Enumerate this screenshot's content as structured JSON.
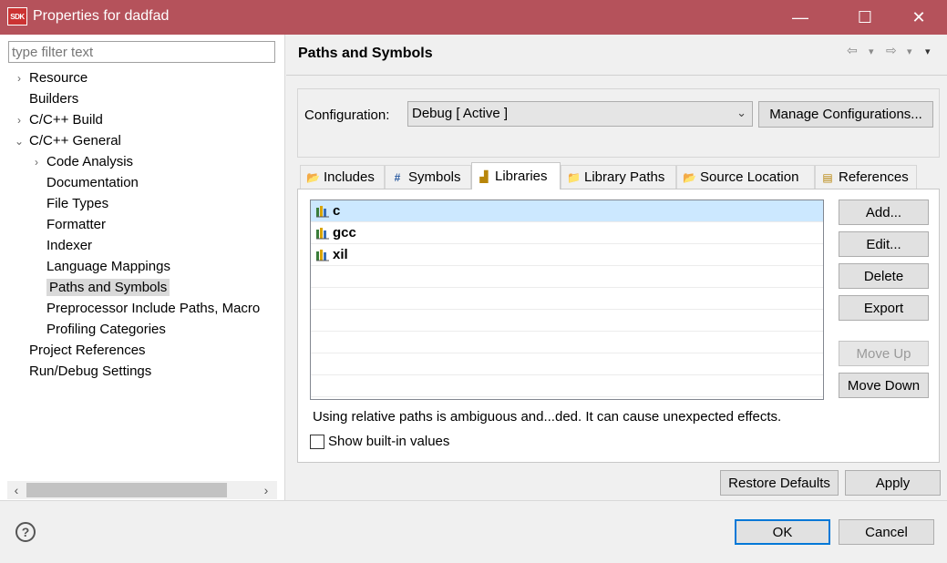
{
  "window": {
    "app_icon_text": "SDK",
    "title": "Properties for dadfad",
    "minimize": "—",
    "maximize": "☐",
    "close": "✕"
  },
  "filter": {
    "placeholder": "type filter text",
    "value": ""
  },
  "tree": [
    {
      "label": "Resource",
      "arrow": "›",
      "indent": 0
    },
    {
      "label": "Builders",
      "arrow": "",
      "indent": 0
    },
    {
      "label": "C/C++ Build",
      "arrow": "›",
      "indent": 0
    },
    {
      "label": "C/C++ General",
      "arrow": "⌄",
      "indent": 0
    },
    {
      "label": "Code Analysis",
      "arrow": "›",
      "indent": 1
    },
    {
      "label": "Documentation",
      "arrow": "",
      "indent": 1
    },
    {
      "label": "File Types",
      "arrow": "",
      "indent": 1
    },
    {
      "label": "Formatter",
      "arrow": "",
      "indent": 1
    },
    {
      "label": "Indexer",
      "arrow": "",
      "indent": 1
    },
    {
      "label": "Language Mappings",
      "arrow": "",
      "indent": 1
    },
    {
      "label": "Paths and Symbols",
      "arrow": "",
      "indent": 1,
      "selected": true
    },
    {
      "label": "Preprocessor Include Paths, Macro",
      "arrow": "",
      "indent": 1
    },
    {
      "label": "Profiling Categories",
      "arrow": "",
      "indent": 1
    },
    {
      "label": "Project References",
      "arrow": "",
      "indent": 0
    },
    {
      "label": "Run/Debug Settings",
      "arrow": "",
      "indent": 0
    }
  ],
  "scrollbar": {
    "left_arrow": "‹",
    "right_arrow": "›"
  },
  "page": {
    "title": "Paths and Symbols",
    "nav": {
      "back": "⇦",
      "back_menu": "▾",
      "forward": "⇨",
      "forward_menu": "▾",
      "view_menu": "▾"
    }
  },
  "configuration": {
    "label": "Configuration:",
    "selected": "Debug  [ Active ]",
    "chevron": "⌄",
    "manage_label": "Manage Configurations..."
  },
  "tabs": [
    {
      "label": "Includes",
      "icon": "includes-icon",
      "glyph": "📂",
      "active": false
    },
    {
      "label": "Symbols",
      "icon": "hash-icon",
      "glyph": "#",
      "active": false
    },
    {
      "label": "Libraries",
      "icon": "libraries-icon",
      "glyph": "▟",
      "active": true
    },
    {
      "label": "Library Paths",
      "icon": "library-paths-icon",
      "glyph": "📁",
      "active": false
    },
    {
      "label": "Source Location",
      "icon": "source-location-icon",
      "glyph": "📂",
      "active": false
    },
    {
      "label": "References",
      "icon": "references-icon",
      "glyph": "▤",
      "active": false
    }
  ],
  "libraries": [
    {
      "name": "c",
      "selected": true
    },
    {
      "name": "gcc",
      "selected": false
    },
    {
      "name": "xil",
      "selected": false
    }
  ],
  "side_buttons": {
    "add": "Add...",
    "edit": "Edit...",
    "delete": "Delete",
    "export": "Export",
    "move_up": "Move Up",
    "move_down": "Move Down"
  },
  "warning": "Using relative paths is ambiguous and...ded. It can cause unexpected effects.",
  "show_builtin": {
    "label": "Show built-in values",
    "checked": false
  },
  "bottom_buttons": {
    "restore": "Restore Defaults",
    "apply": "Apply"
  },
  "footer": {
    "help": "?",
    "ok": "OK",
    "cancel": "Cancel"
  },
  "colors": {
    "titlebar": "#b5525b",
    "selection": "#cce8ff",
    "default_border": "#0078d7"
  }
}
